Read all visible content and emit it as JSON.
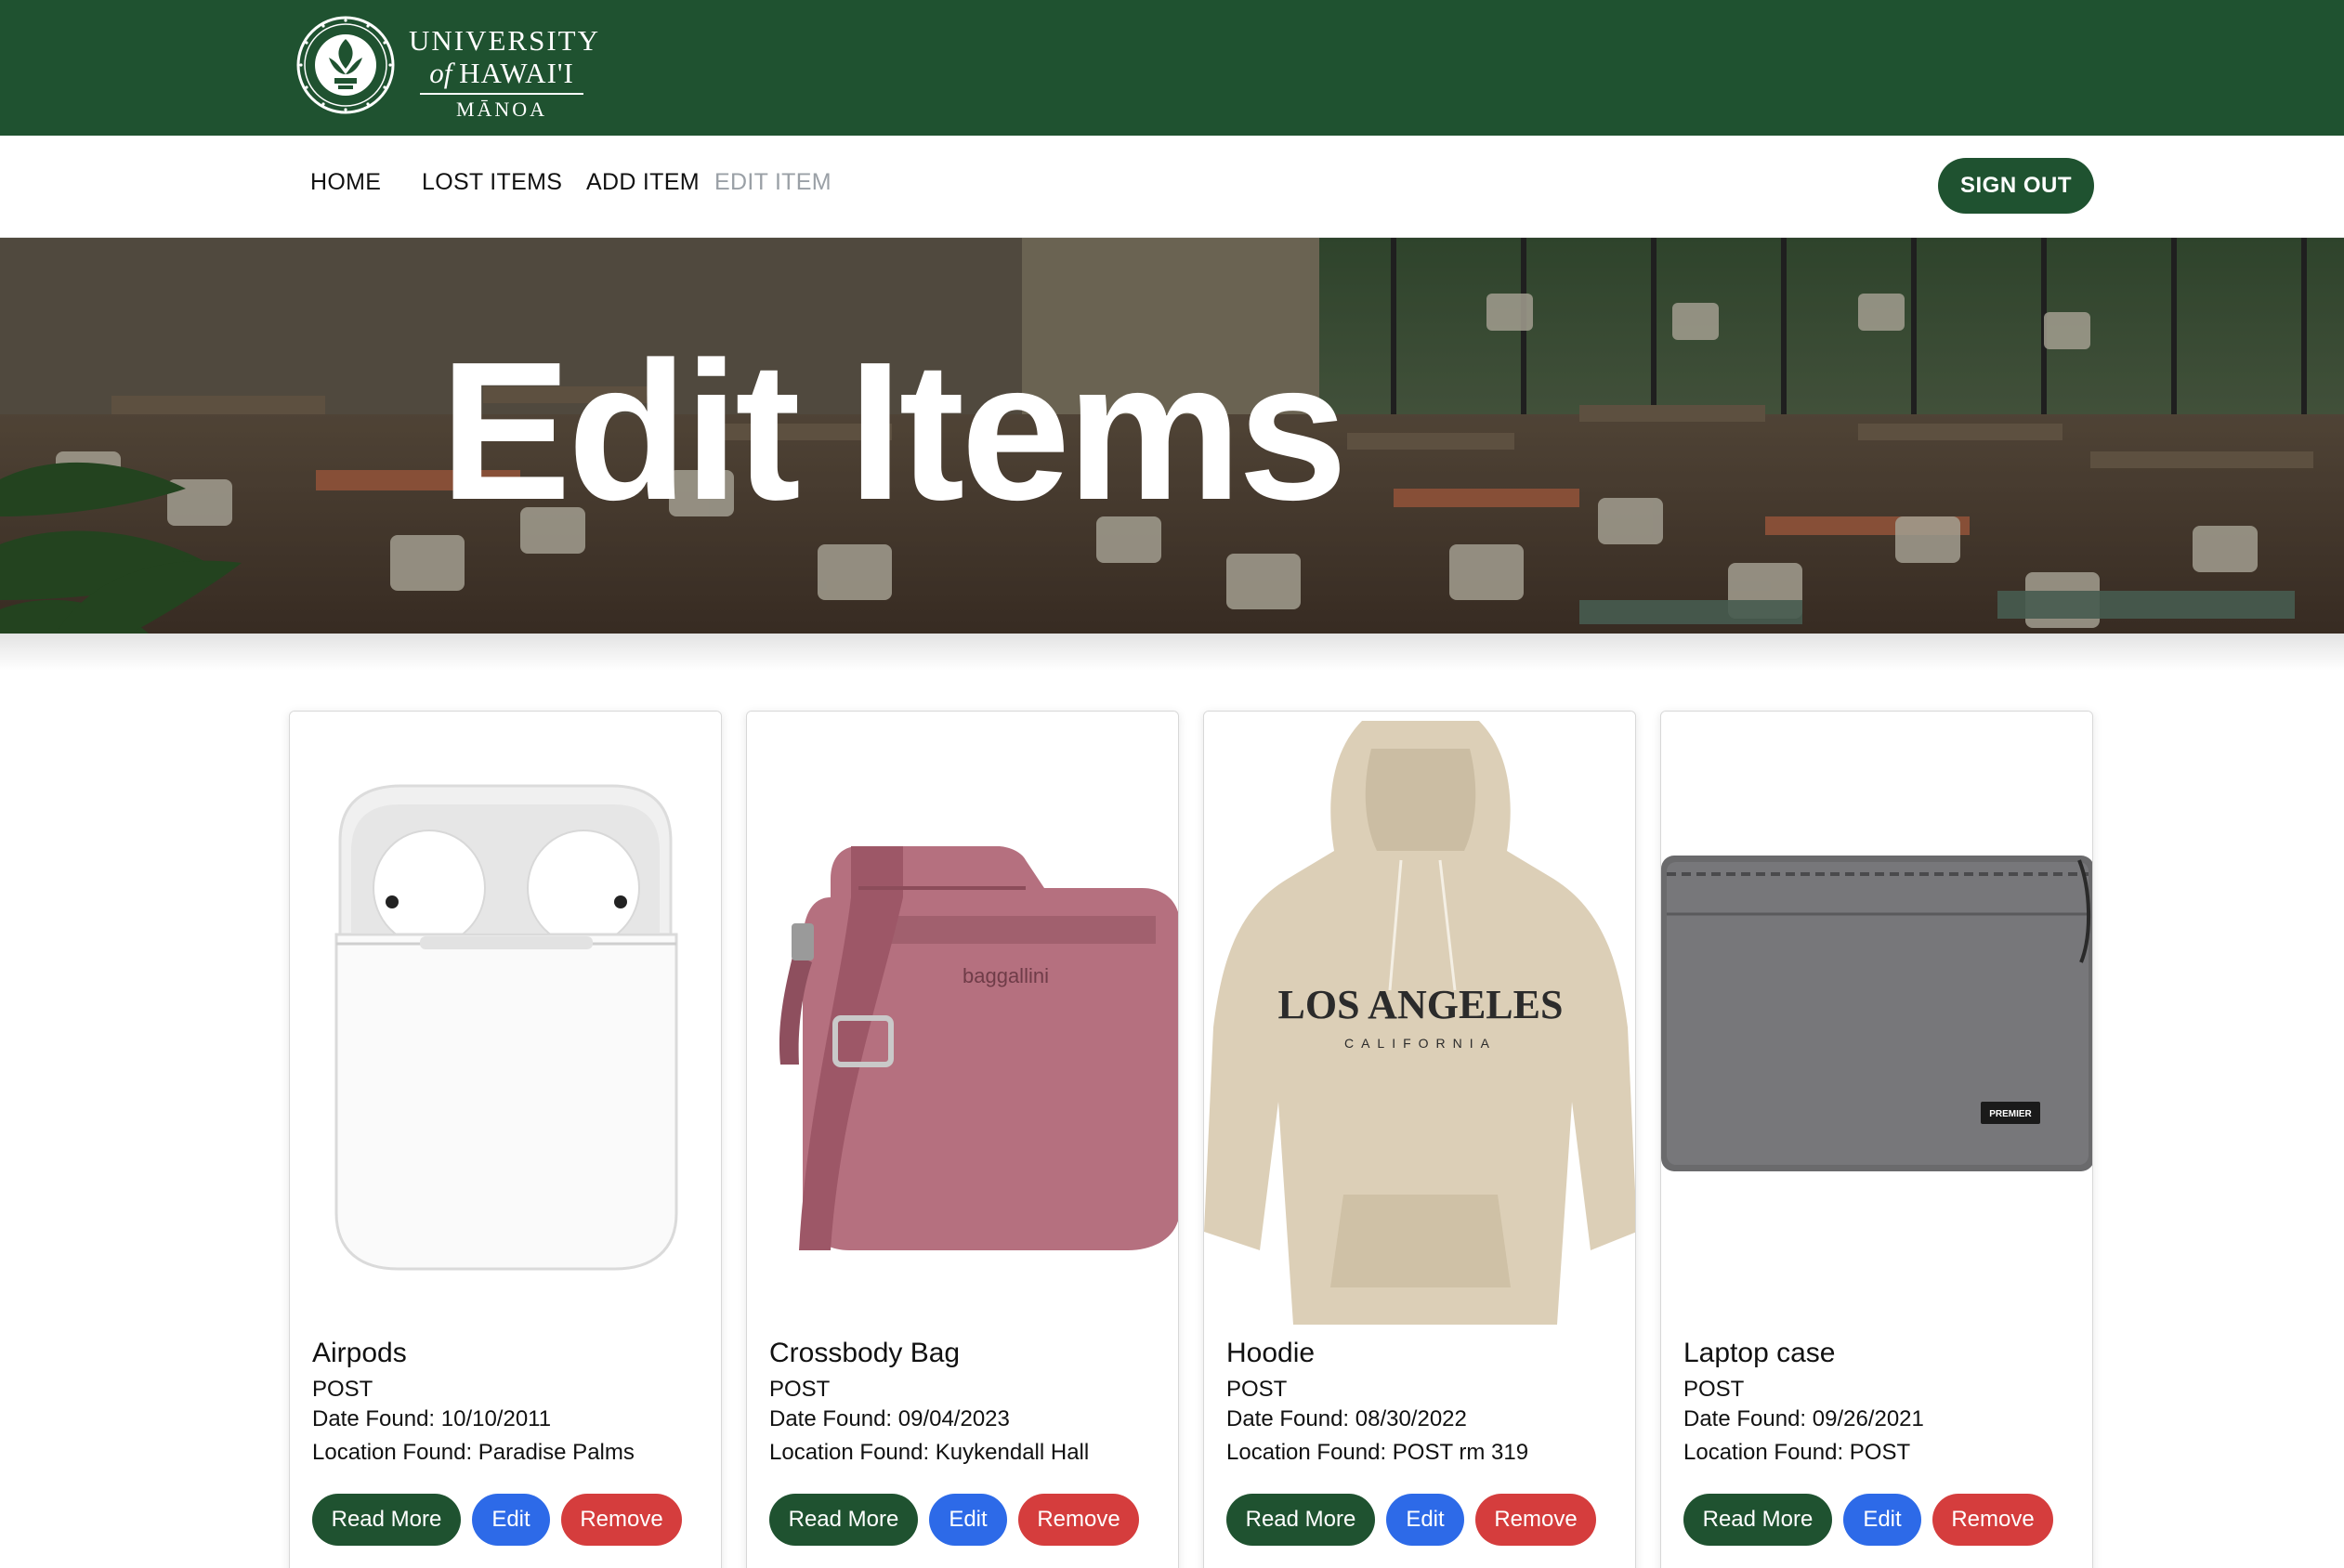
{
  "header": {
    "logo_line1": "UNIVERSITY",
    "logo_line2_a": "of ",
    "logo_line2_b": "HAWAI'I",
    "logo_line3": "MĀNOA",
    "brand_color": "#1f5230"
  },
  "nav": {
    "home": "HOME",
    "lost_items": "LOST ITEMS",
    "add_item": "ADD ITEM",
    "edit_item": "EDIT ITEM",
    "sign_out": "SIGN OUT"
  },
  "hero": {
    "title": "Edit Items"
  },
  "colors": {
    "read_more": "#1f5230",
    "edit": "#2d6ae8",
    "remove": "#d53d3d"
  },
  "cards": [
    {
      "title": "Airpods",
      "building": "POST",
      "date": "Date Found: 10/10/2011",
      "location": "Location Found: Paradise Palms",
      "image_icon": "airpods-image",
      "read_more": "Read More",
      "edit": "Edit",
      "remove": "Remove"
    },
    {
      "title": "Crossbody Bag",
      "building": "POST",
      "date": "Date Found: 09/04/2023",
      "location": "Location Found: Kuykendall Hall",
      "image_icon": "bag-image",
      "image_text": "baggallini",
      "read_more": "Read More",
      "edit": "Edit",
      "remove": "Remove"
    },
    {
      "title": "Hoodie",
      "building": "POST",
      "date": "Date Found: 08/30/2022",
      "location": "Location Found: POST rm 319",
      "image_icon": "hoodie-image",
      "image_text": "LOS ANGELES",
      "image_subtext": "CALIFORNIA",
      "read_more": "Read More",
      "edit": "Edit",
      "remove": "Remove"
    },
    {
      "title": "Laptop case",
      "building": "POST",
      "date": "Date Found: 09/26/2021",
      "location": "Location Found: POST",
      "image_icon": "laptop-case-image",
      "image_text": "PREMIER",
      "read_more": "Read More",
      "edit": "Edit",
      "remove": "Remove"
    }
  ]
}
